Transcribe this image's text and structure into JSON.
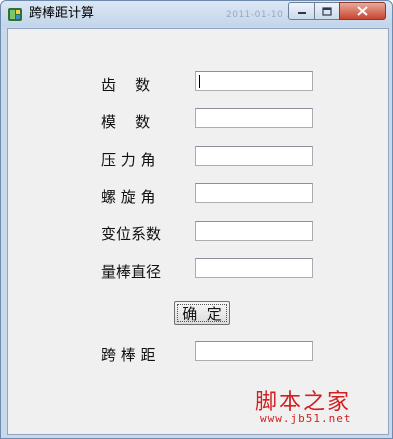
{
  "window": {
    "title": "跨棒距计算",
    "title_ghost": "2011-01-10 ..."
  },
  "form": {
    "labels": [
      "齿    数",
      "模    数",
      "压 力 角",
      "螺 旋 角",
      "变位系数",
      "量棒直径"
    ],
    "values": [
      "",
      "",
      "",
      "",
      "",
      ""
    ],
    "confirm_label": "确  定",
    "result_label": "跨 棒 距",
    "result_value": ""
  },
  "watermark": {
    "text": "脚本之家",
    "url": "www.jb51.net"
  },
  "colors": {
    "window_frame": "#c9d9ea",
    "client_bg": "#f0f0f0",
    "close_button": "#c8452e",
    "watermark": "#d21f1f"
  },
  "icons": {
    "app": "app-icon",
    "minimize": "minimize-icon",
    "maximize": "maximize-icon",
    "close": "close-icon"
  }
}
